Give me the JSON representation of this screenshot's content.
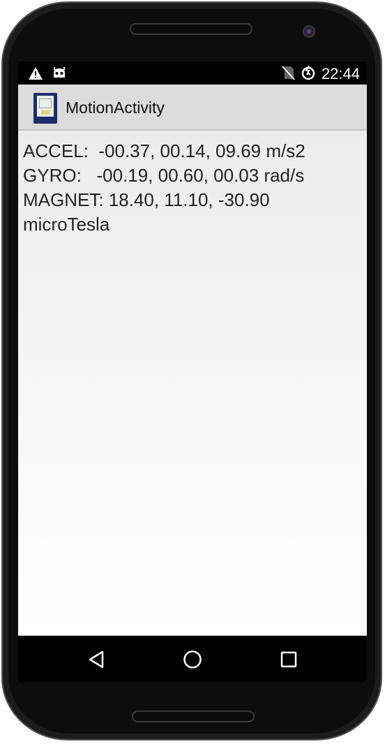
{
  "status_bar": {
    "time": "22:44",
    "icons_left": [
      "warning-icon",
      "android-debug-icon"
    ],
    "icons_right": [
      "no-sim-icon",
      "alarm-icon"
    ]
  },
  "action_bar": {
    "app_icon": "app-launcher-icon",
    "title": "MotionActivity"
  },
  "sensors": {
    "accel": "ACCEL:  -00.37, 00.14, 09.69 m/s2",
    "gyro": "GYRO:   -00.19, 00.60, 00.03 rad/s",
    "magnet": "MAGNET: 18.40, 11.10, -30.90 microTesla"
  },
  "navigation": {
    "back": "back-icon",
    "home": "home-icon",
    "recents": "recents-icon"
  },
  "colors": {
    "action_bar": "#dcdcdc",
    "status_bar": "#000000",
    "text": "#222222"
  }
}
